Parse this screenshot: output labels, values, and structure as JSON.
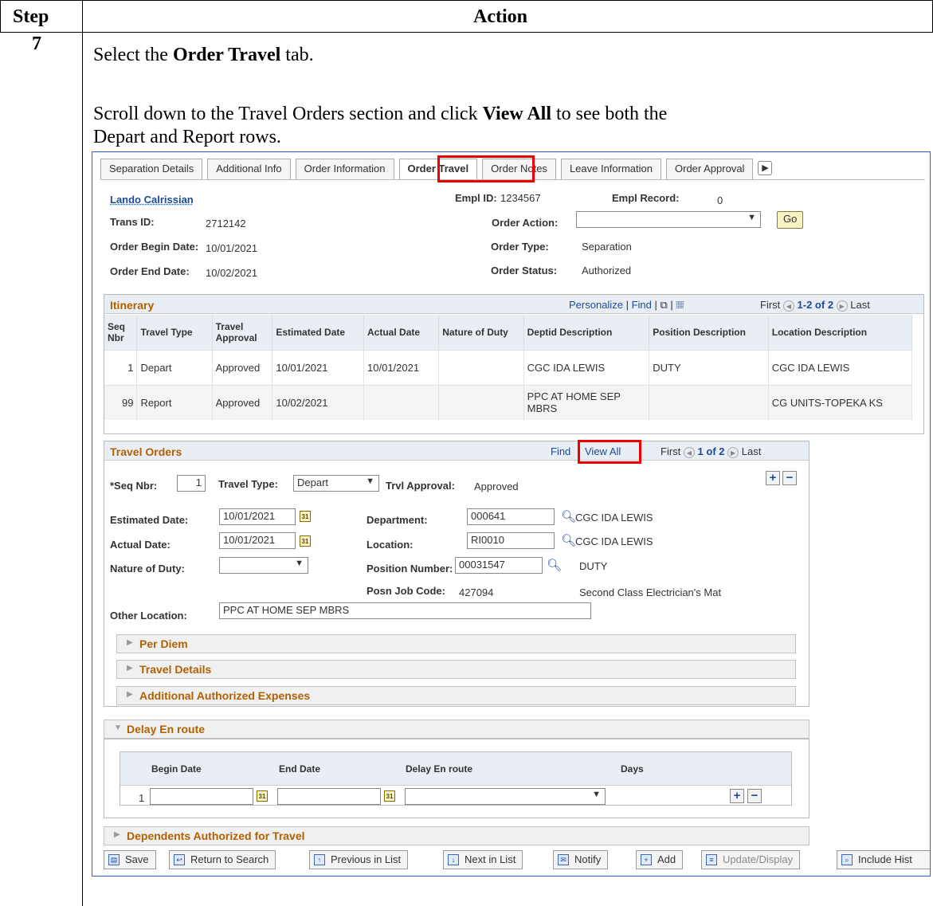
{
  "doc": {
    "header_step": "Step",
    "header_action": "Action",
    "step_number": "7",
    "line1_prefix": "Select the ",
    "line1_bold": "Order Travel",
    "line1_suffix": " tab.",
    "line2_prefix": "Scroll down to the Travel Orders section and click ",
    "line2_bold": "View All",
    "line2_suffix": " to see both the",
    "line3": "Depart and Report rows."
  },
  "tabs": [
    "Separation Details",
    "Additional Info",
    "Order Information",
    "Order Travel",
    "Order Notes",
    "Leave Information",
    "Order Approval"
  ],
  "header": {
    "name": "Lando Calrissian",
    "trans_id_label": "Trans ID:",
    "trans_id": "2712142",
    "begin_label": "Order Begin Date:",
    "begin": "10/01/2021",
    "end_label": "Order End Date:",
    "end": "10/02/2021",
    "empl_id_label": "Empl ID:",
    "empl_id": "1234567",
    "empl_record_label": "Empl Record:",
    "empl_record": "0",
    "order_action_label": "Order Action:",
    "order_action": "",
    "go": "Go",
    "order_type_label": "Order Type:",
    "order_type": "Separation",
    "order_status_label": "Order Status:",
    "order_status": "Authorized"
  },
  "itinerary": {
    "title": "Itinerary",
    "personalize": "Personalize",
    "find": "Find",
    "first": "First",
    "range": "1-2 of 2",
    "last": "Last",
    "columns": [
      "Seq Nbr",
      "Travel Type",
      "Travel Approval",
      "Estimated Date",
      "Actual Date",
      "Nature of Duty",
      "Deptid Description",
      "Position Description",
      "Location Description"
    ],
    "rows": [
      [
        "1",
        "Depart",
        "Approved",
        "10/01/2021",
        "10/01/2021",
        "",
        "CGC IDA LEWIS",
        "DUTY",
        "CGC IDA LEWIS"
      ],
      [
        "99",
        "Report",
        "Approved",
        "10/02/2021",
        "",
        "",
        "PPC AT HOME SEP MBRS",
        "",
        "CG UNITS-TOPEKA KS"
      ]
    ]
  },
  "travel_orders": {
    "title": "Travel Orders",
    "find": "Find",
    "view_all": "View All",
    "first": "First",
    "range": "1 of 2",
    "last": "Last",
    "seq_label": "*Seq Nbr:",
    "seq": "1",
    "travel_type_label": "Travel Type:",
    "travel_type": "Depart",
    "approval_label": "Trvl Approval:",
    "approval": "Approved",
    "est_label": "Estimated Date:",
    "est": "10/01/2021",
    "act_label": "Actual Date:",
    "act": "10/01/2021",
    "nature_label": "Nature of Duty:",
    "nature": "",
    "dept_label": "Department:",
    "dept": "000641",
    "dept_desc": "CGC IDA LEWIS",
    "loc_label": "Location:",
    "loc": "RI0010",
    "loc_desc": "CGC IDA LEWIS",
    "posn_label": "Position Number:",
    "posn": "00031547",
    "posn_desc": "DUTY",
    "job_label": "Posn Job Code:",
    "job": "427094",
    "job_desc": "Second Class Electrician's Mat",
    "other_label": "Other Location:",
    "other": "PPC AT HOME SEP MBRS",
    "sections": [
      "Per Diem",
      "Travel Details",
      "Additional Authorized Expenses"
    ]
  },
  "delay": {
    "title": "Delay En route",
    "columns": [
      "Begin Date",
      "End Date",
      "Delay En route",
      "Days"
    ],
    "row_num": "1"
  },
  "dependents": {
    "title": "Dependents Authorized for Travel"
  },
  "toolbar": [
    "Save",
    "Return to Search",
    "Previous in List",
    "Next in List",
    "Notify",
    "Add",
    "Update/Display",
    "Include Hist"
  ]
}
